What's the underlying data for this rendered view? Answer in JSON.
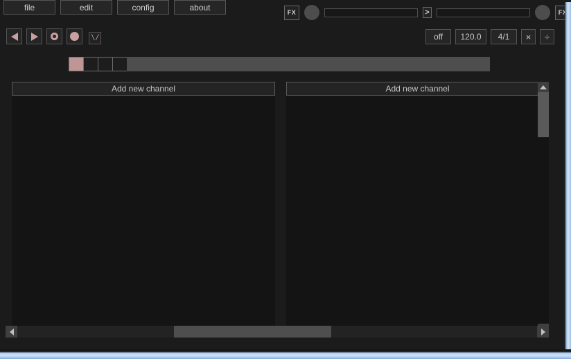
{
  "app": {
    "accent_pink": "#c9a0a0",
    "background": "#1b1b1b",
    "panel": "#262626",
    "border": "#555555"
  },
  "menubar": {
    "items": [
      {
        "label": "file",
        "name": "menu-file"
      },
      {
        "label": "edit",
        "name": "menu-edit"
      },
      {
        "label": "config",
        "name": "menu-config"
      },
      {
        "label": "about",
        "name": "menu-about"
      }
    ]
  },
  "master": {
    "fx_in_label": "FX",
    "fx_out_label": "FX",
    "in_meter_value": "",
    "out_meter_value": "",
    "in_arrow_label": ">",
    "out_arrow_label": ">",
    "in_volume_icon": "knob-icon",
    "out_volume_icon": "knob-icon"
  },
  "transport": {
    "rewind_icon": "rewind-icon",
    "play_icon": "play-icon",
    "record_action_icon": "record-ring-icon",
    "record_input_icon": "record-dot-icon",
    "metronome_icon": "metronome-icon",
    "metronome_glyph": "\\/"
  },
  "clock": {
    "quantizer": "off",
    "bpm": "120.0",
    "beats": "4/1",
    "multiply_label": "×",
    "divide_label": "÷"
  },
  "beatmeter": {
    "cells": [
      {
        "active": true
      },
      {
        "active": false
      },
      {
        "active": false
      },
      {
        "active": false
      }
    ],
    "active_color": "#c09595",
    "bar_color": "#4e4e4e"
  },
  "columns": [
    {
      "add_label": "Add new channel",
      "name": "column-left"
    },
    {
      "add_label": "Add new channel",
      "name": "column-right"
    }
  ],
  "scrollbars": {
    "vertical": {
      "up_icon": "arrow-up-icon",
      "down_icon": "arrow-down-icon",
      "thumb_top_pct": 4,
      "thumb_height_pct": 18
    },
    "horizontal": {
      "left_icon": "arrow-left-icon",
      "right_icon": "arrow-right-icon",
      "thumb_left_pct": 31,
      "thumb_width_pct": 29
    }
  }
}
